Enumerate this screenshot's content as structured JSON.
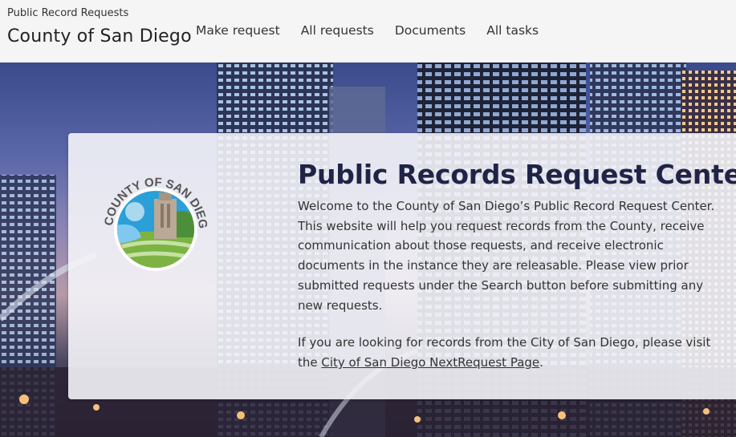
{
  "header": {
    "subtitle": "Public Record Requests",
    "title": "County of San Diego",
    "nav": [
      {
        "label": "Make request"
      },
      {
        "label": "All requests"
      },
      {
        "label": "Documents"
      },
      {
        "label": "All tasks"
      }
    ]
  },
  "hero": {
    "heading": "Public Records Request Center",
    "intro": "Welcome to the County of San Diego’s Public Record Request Center. This website will help you request records from the County, receive communication about those requests, and receive electronic documents in the instance they are releasable. Please view prior submitted requests under the Search button before submitting any new requests.",
    "city_prefix": "If you are looking for records from the City of San Diego, please visit the ",
    "city_link": "City of San Diego NextRequest Page",
    "city_suffix": ".",
    "logo_text": "COUNTY OF SAN DIEGO"
  },
  "colors": {
    "heading": "#1f2447",
    "logo_sky": "#2b9fd8",
    "logo_green": "#7cb342",
    "logo_orange": "#f29a36"
  }
}
